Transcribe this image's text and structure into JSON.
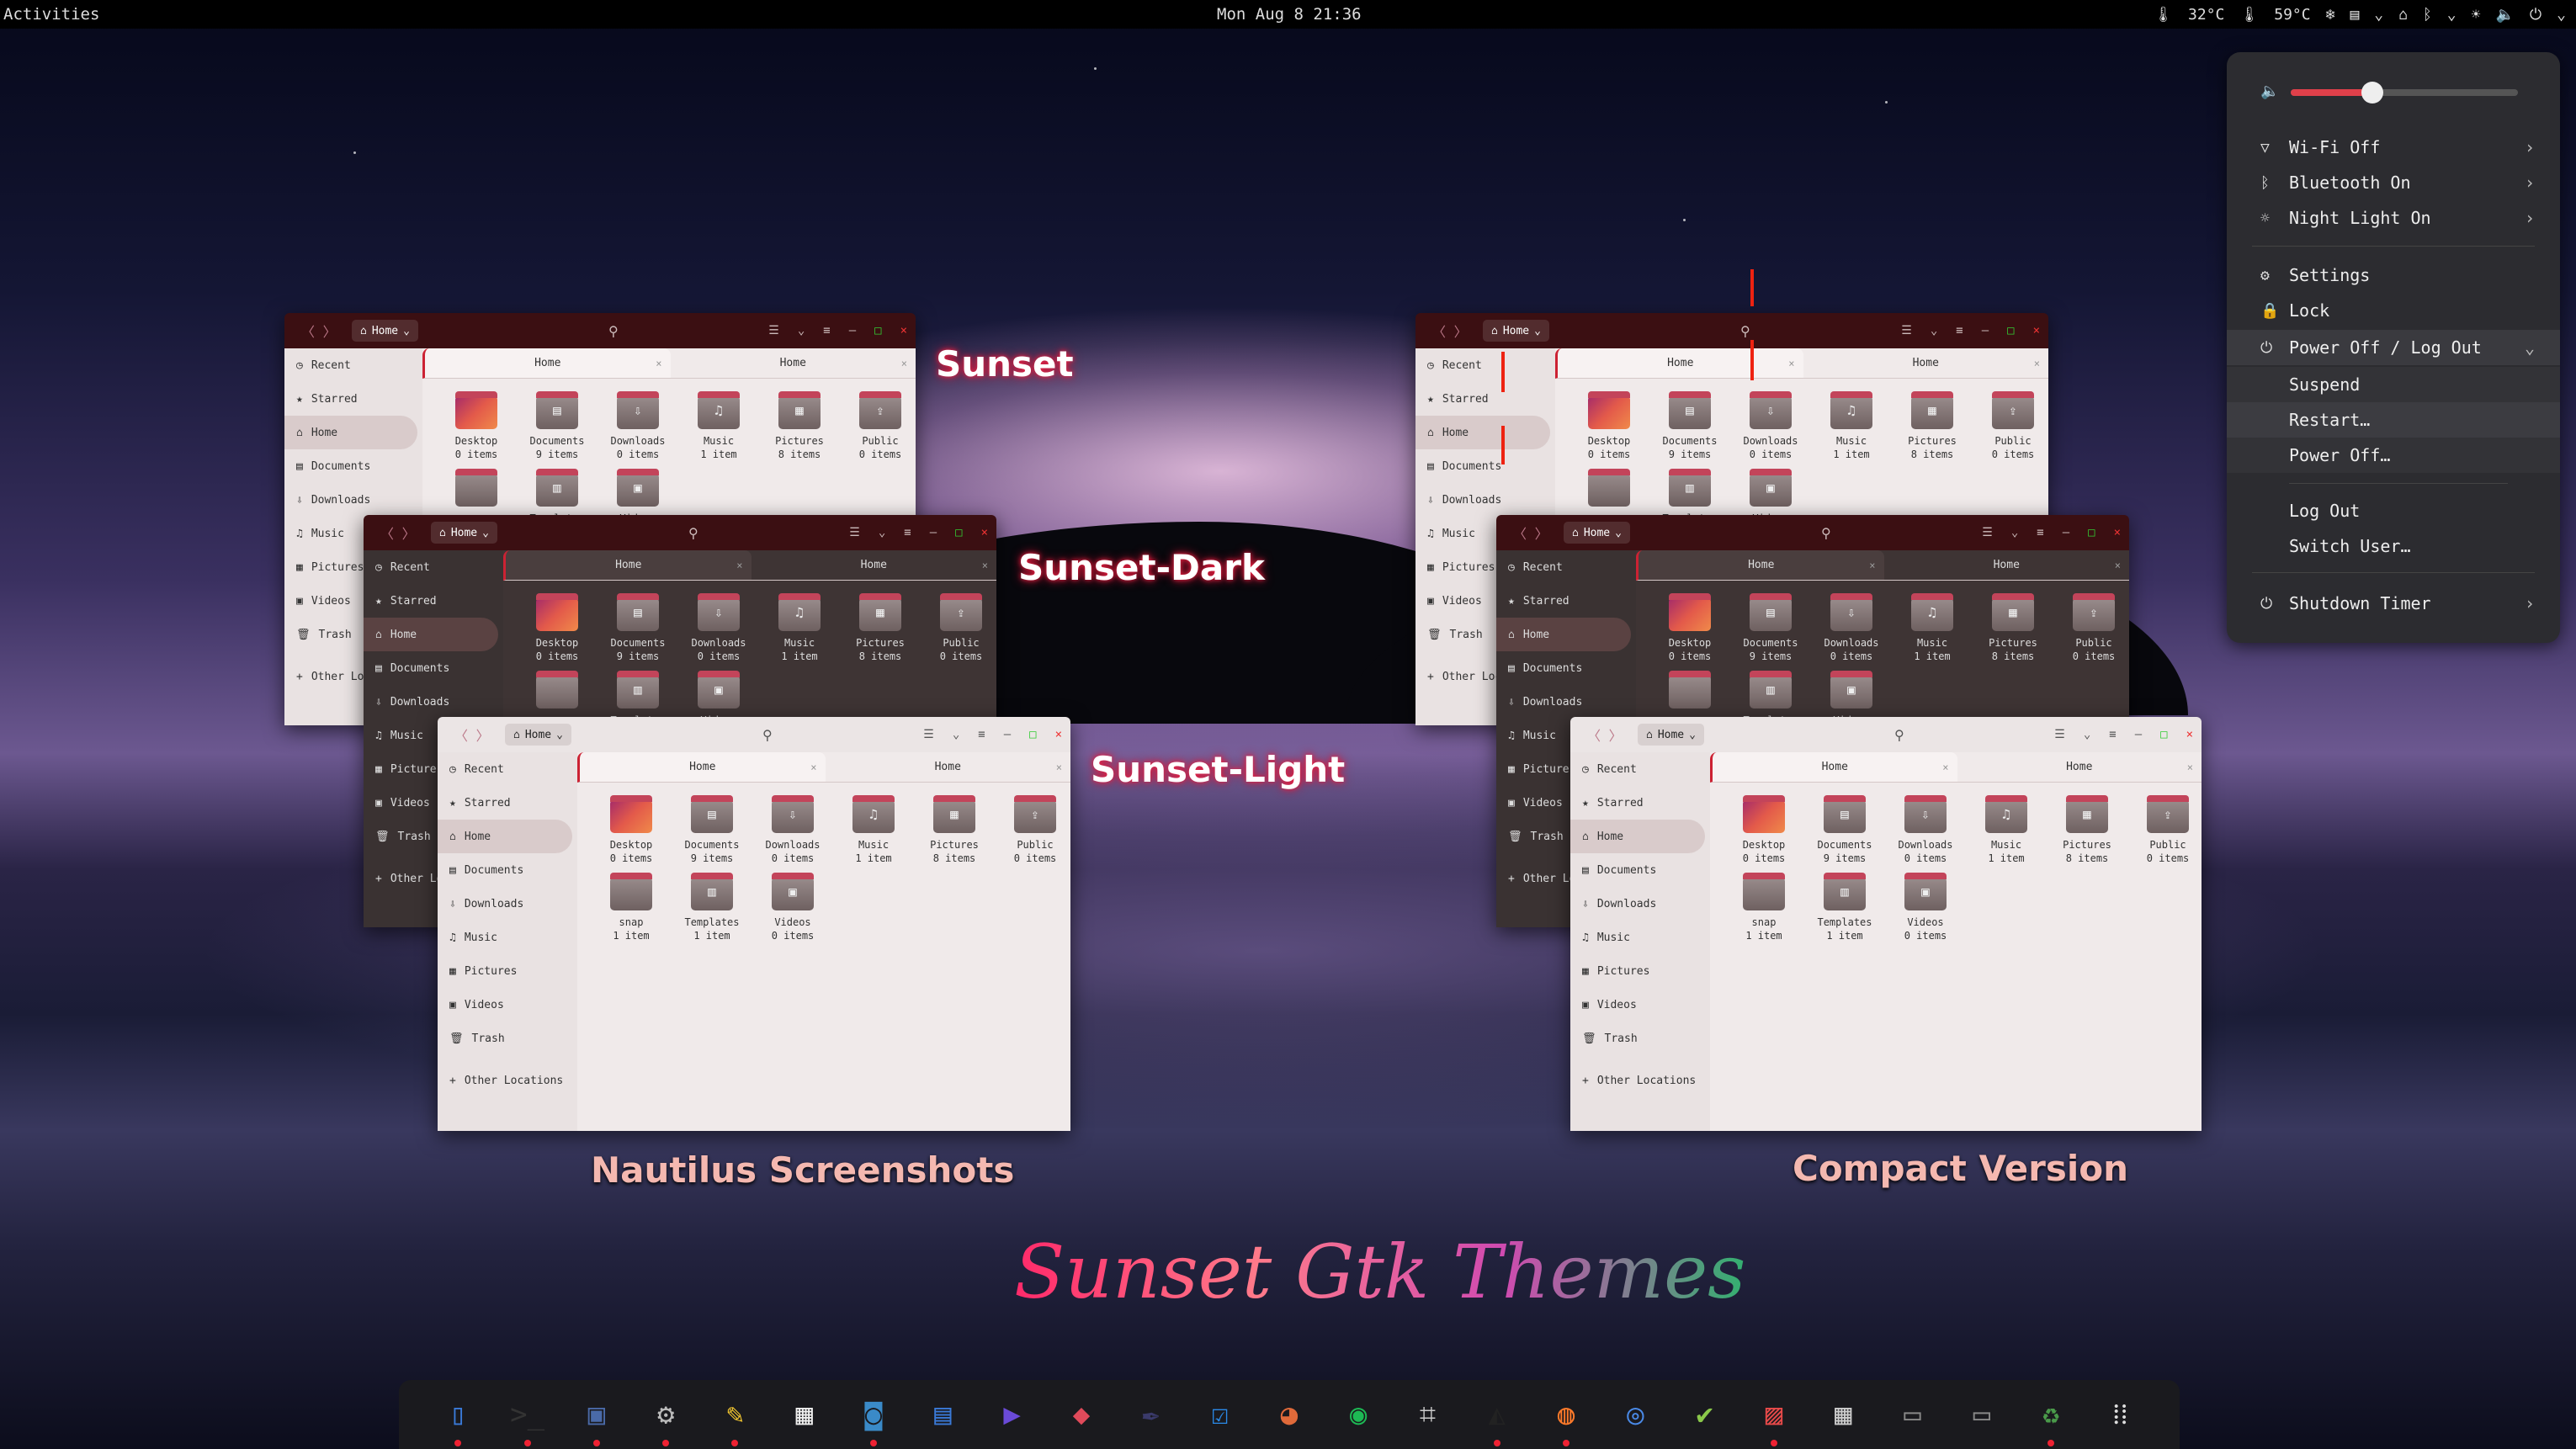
{
  "topbar": {
    "activities": "Activities",
    "clock": "Mon Aug 8 21:36",
    "temp1": "32°C",
    "temp2": "59°C"
  },
  "quickmenu": {
    "wifi": "Wi-Fi Off",
    "bluetooth": "Bluetooth On",
    "nightlight": "Night Light On",
    "settings": "Settings",
    "lock": "Lock",
    "power": "Power Off / Log Out",
    "suspend": "Suspend",
    "restart": "Restart…",
    "poweroff": "Power Off…",
    "logout": "Log Out",
    "switchuser": "Switch User…",
    "shutdown_timer": "Shutdown Timer",
    "volume_level": 0.3
  },
  "window": {
    "path": "Home",
    "tab1": "Home",
    "tab2": "Home",
    "sidebar": [
      "Recent",
      "Starred",
      "Home",
      "Documents",
      "Downloads",
      "Music",
      "Pictures",
      "Videos",
      "Trash",
      "Other Locations"
    ],
    "files": [
      {
        "name": "Desktop",
        "count": "0 items"
      },
      {
        "name": "Documents",
        "count": "9 items"
      },
      {
        "name": "Downloads",
        "count": "0 items"
      },
      {
        "name": "Music",
        "count": "1 item"
      },
      {
        "name": "Pictures",
        "count": "8 items"
      },
      {
        "name": "Public",
        "count": "0 items"
      },
      {
        "name": "snap",
        "count": "1 item"
      },
      {
        "name": "Templates",
        "count": "1 item"
      },
      {
        "name": "Videos",
        "count": "0 items"
      }
    ]
  },
  "labels": {
    "sunset": "Sunset",
    "sunset_dark": "Sunset-Dark",
    "sunset_light": "Sunset-Light",
    "nautilus": "Nautilus Screenshots",
    "compact": "Compact Version",
    "brand": "Sunset Gtk Themes"
  },
  "colors": {
    "accent": "#c3445a",
    "header_dark": "#3b0f12",
    "light_bg": "#f0eaea"
  },
  "dock_icons": [
    "files",
    "terminal",
    "software",
    "settings",
    "notes",
    "calendar",
    "screenshot",
    "document",
    "play",
    "apps",
    "pen",
    "tasks",
    "color",
    "spotify",
    "ruler",
    "inkscape",
    "firefox",
    "chromium",
    "check",
    "news",
    "calculator",
    "drive",
    "drive2",
    "recycle",
    "grid"
  ]
}
